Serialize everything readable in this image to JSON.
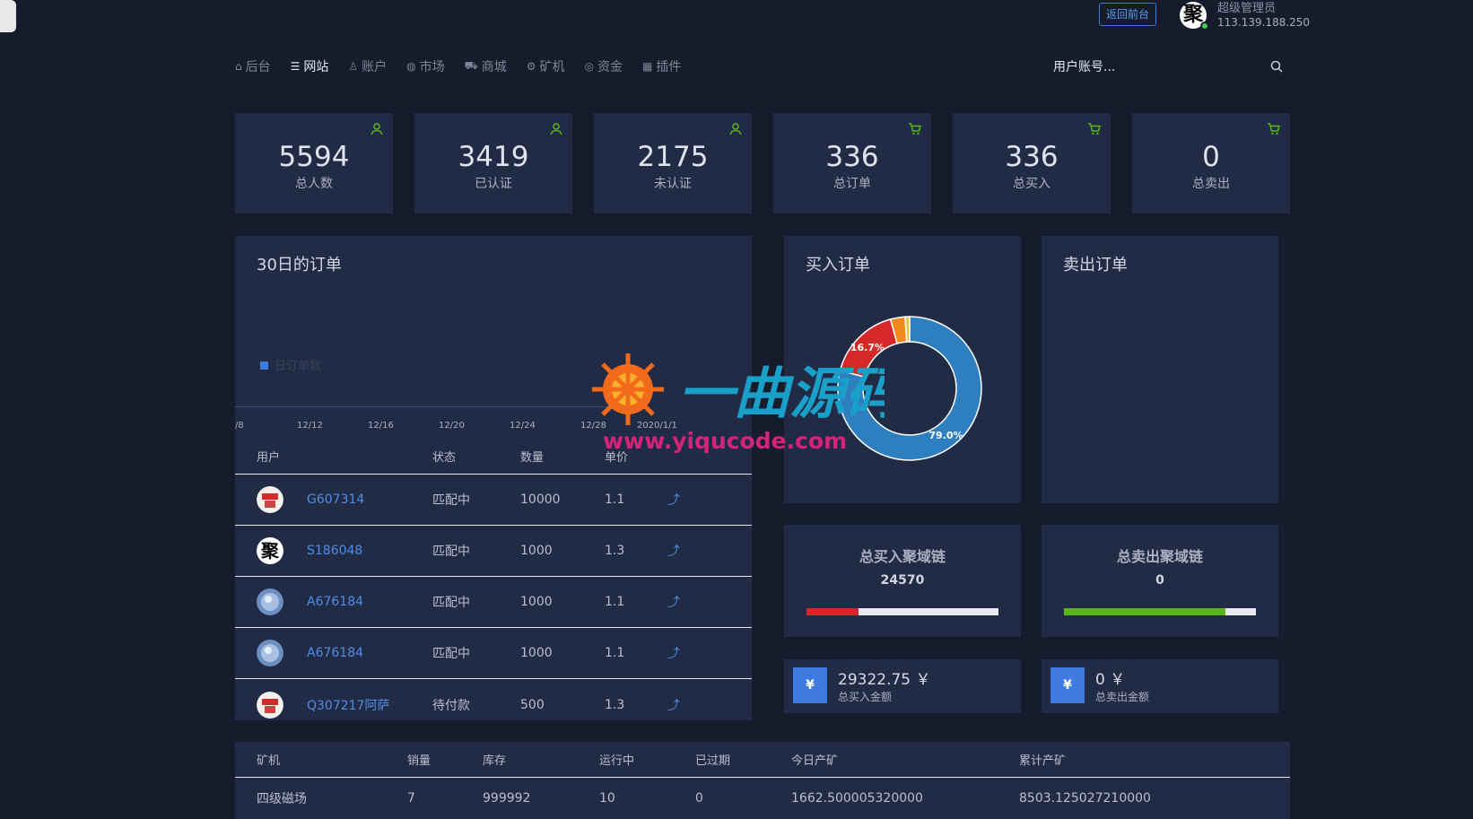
{
  "header": {
    "back_button": "返回前台",
    "admin_avatar_char": "聚",
    "admin_role": "超级管理员",
    "admin_ip": "113.139.188.250"
  },
  "nav": {
    "items": [
      {
        "label": "后台",
        "icon": "home-icon"
      },
      {
        "label": "网站",
        "icon": "list-icon"
      },
      {
        "label": "账户",
        "icon": "users-icon"
      },
      {
        "label": "市场",
        "icon": "globe-icon"
      },
      {
        "label": "商城",
        "icon": "cart-icon"
      },
      {
        "label": "矿机",
        "icon": "cog-icon"
      },
      {
        "label": "资金",
        "icon": "coin-icon"
      },
      {
        "label": "插件",
        "icon": "grid-icon"
      }
    ],
    "active_index": 1,
    "search_placeholder": "用户账号..."
  },
  "stats": [
    {
      "value": "5594",
      "label": "总人数",
      "icon": "user-icon"
    },
    {
      "value": "3419",
      "label": "已认证",
      "icon": "user-icon"
    },
    {
      "value": "2175",
      "label": "未认证",
      "icon": "user-icon"
    },
    {
      "value": "336",
      "label": "总订单",
      "icon": "cart-icon"
    },
    {
      "value": "336",
      "label": "总买入",
      "icon": "cart-icon"
    },
    {
      "value": "0",
      "label": "总卖出",
      "icon": "cart-icon"
    }
  ],
  "orders_chart": {
    "title": "30日的订单",
    "legend": "日订单数",
    "x_ticks": [
      "/8",
      "12/12",
      "12/16",
      "12/20",
      "12/24",
      "12/28",
      "2020/1/1"
    ]
  },
  "orders_table": {
    "headers": [
      "用户",
      "状态",
      "数量",
      "单价"
    ],
    "rows": [
      {
        "user": "G607314",
        "status": "匹配中",
        "qty": "10000",
        "price": "1.1",
        "avatar": "badge"
      },
      {
        "user": "S186048",
        "status": "匹配中",
        "qty": "1000",
        "price": "1.3",
        "avatar": "char"
      },
      {
        "user": "A676184",
        "status": "匹配中",
        "qty": "1000",
        "price": "1.1",
        "avatar": "blue"
      },
      {
        "user": "A676184",
        "status": "匹配中",
        "qty": "1000",
        "price": "1.1",
        "avatar": "blue"
      },
      {
        "user": "Q307217阿萨",
        "status": "待付款",
        "qty": "500",
        "price": "1.3",
        "avatar": "badge"
      }
    ],
    "avatar_char": "聚",
    "action_icon": "share-icon"
  },
  "buy_orders": {
    "title": "买入订单",
    "labels": [
      "16.7%",
      "79.0%"
    ]
  },
  "sell_orders": {
    "title": "卖出订单"
  },
  "chart_data": {
    "type": "pie",
    "title": "买入订单",
    "slices": [
      {
        "value": 79.0,
        "label": "79.0%",
        "color": "#2e7fc0"
      },
      {
        "value": 16.7,
        "label": "16.7%",
        "color": "#d62828"
      },
      {
        "value": 3.3,
        "label": "",
        "color": "#f08a1c"
      },
      {
        "value": 1.0,
        "label": "",
        "color": "#e6c84a"
      }
    ]
  },
  "totals": {
    "buy_title": "总买入聚域链",
    "buy_value": "24570",
    "buy_fill": 0.27,
    "buy_color": "#d62828",
    "sell_title": "总卖出聚域链",
    "sell_value": "0",
    "sell_fill": 0.84,
    "sell_color": "#5bb51a"
  },
  "amounts": {
    "yen": "¥",
    "buy_amount": "29322.75 ￥",
    "buy_label": "总买入金额",
    "sell_amount": "0 ￥",
    "sell_label": "总卖出金额"
  },
  "miner_table": {
    "headers": [
      "矿机",
      "销量",
      "库存",
      "运行中",
      "已过期",
      "今日产矿",
      "累计产矿"
    ],
    "rows": [
      [
        "四级磁场",
        "7",
        "999992",
        "10",
        "0",
        "1662.500005320000",
        "8503.125027210000"
      ]
    ]
  },
  "watermark": {
    "text": "一曲源码",
    "url": "www.yiqucode.com"
  }
}
